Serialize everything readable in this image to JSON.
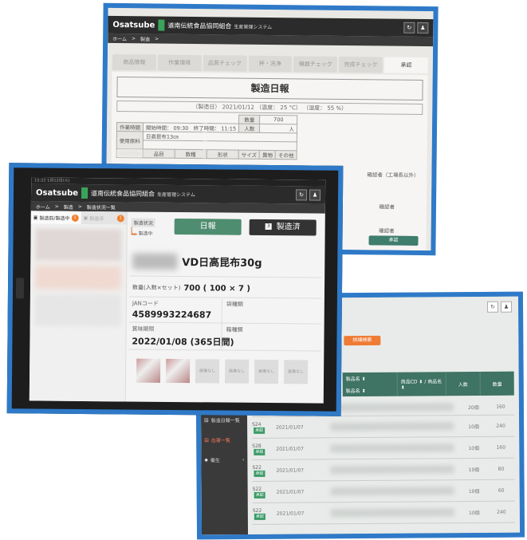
{
  "brand": {
    "logo": "Osatsube",
    "org": "道南伝統食品協同組合",
    "system": "生産管理システム"
  },
  "back_screen": {
    "breadcrumb": [
      "ホーム",
      ">",
      "製造",
      ">"
    ],
    "tabs": [
      "商品情報",
      "作業環境",
      "品質チェック",
      "秤・洗浄",
      "機器チェック",
      "完成チェック",
      "承認"
    ],
    "active_tab": "承認",
    "report_title": "製造日報",
    "report_meta": "（製造日） 2021/01/12 （温度： 25 °C） （湿度： 55 %）",
    "rows": {
      "qty_label": "数量",
      "qty_value": "700",
      "people_label": "人数",
      "people_unit": "人",
      "worktime_label": "作業時間",
      "worktime_value": "開始時間： 09:30　終了時間： 11:15",
      "material_label": "使用原料",
      "material_value": "日高昆布13㎝",
      "cols": [
        "品目",
        "数種",
        "形状",
        "サイズ",
        "異物",
        "その他",
        "確認者（工場長以外）"
      ],
      "confirm_label": "確認者"
    },
    "action_button": "承認"
  },
  "right_screen": {
    "top_icons": [
      "↻",
      "♟"
    ],
    "search_button": "詳細検索",
    "columns": [
      "製品名 ⬍",
      "商品CD ⬍ / 商品名 ⬍",
      "入数",
      "数量"
    ],
    "sub_col": "製品名 ⬍",
    "side_menu": [
      "製造日報一覧",
      "出荷一覧",
      "衛生"
    ],
    "rows": [
      {
        "id": "S24",
        "badge": "承認",
        "date": "2021/01/07",
        "q1": "10個",
        "q2": "240"
      },
      {
        "id": "S28",
        "badge": "承認",
        "date": "2021/01/07",
        "q1": "10個",
        "q2": "160"
      },
      {
        "id": "S22",
        "badge": "承認",
        "date": "2021/01/07",
        "q1": "10個",
        "q2": "80"
      },
      {
        "id": "S22",
        "badge": "承認",
        "date": "2021/01/07",
        "q1": "10個",
        "q2": "60"
      },
      {
        "id": "S22",
        "badge": "承認",
        "date": "2021/01/07",
        "q1": "10個",
        "q2": "240"
      }
    ],
    "first_row": {
      "q1": "20個",
      "q2": "160"
    }
  },
  "front_screen": {
    "statusbar": "15:22 1月12日(火)",
    "breadcrumb": [
      "ホーム",
      ">",
      "製造",
      ">",
      "製造状況一覧"
    ],
    "left_tabs": [
      {
        "label": "製造前/製造中",
        "count": "1"
      },
      {
        "label": "製造済",
        "count": "1"
      }
    ],
    "status_label": "製造状況",
    "status_value": "製造中",
    "btn_nippo": "日報",
    "btn_done_num": "3",
    "btn_done": "製造済",
    "product_name": "VD日高昆布30g",
    "qty_label": "数量(入数×セット)",
    "qty_value": "700 ( 100 × 7 )",
    "jan_label": "JANコード",
    "jan_value": "4589993224687",
    "bag_label": "袋種類",
    "expiry_label": "賞味期限",
    "expiry_value": "2022/01/08 (365日間)",
    "box_label": "箱種類",
    "thumbs": [
      "",
      "",
      "画像なし",
      "画像なし",
      "画像なし",
      "画像なし"
    ]
  }
}
